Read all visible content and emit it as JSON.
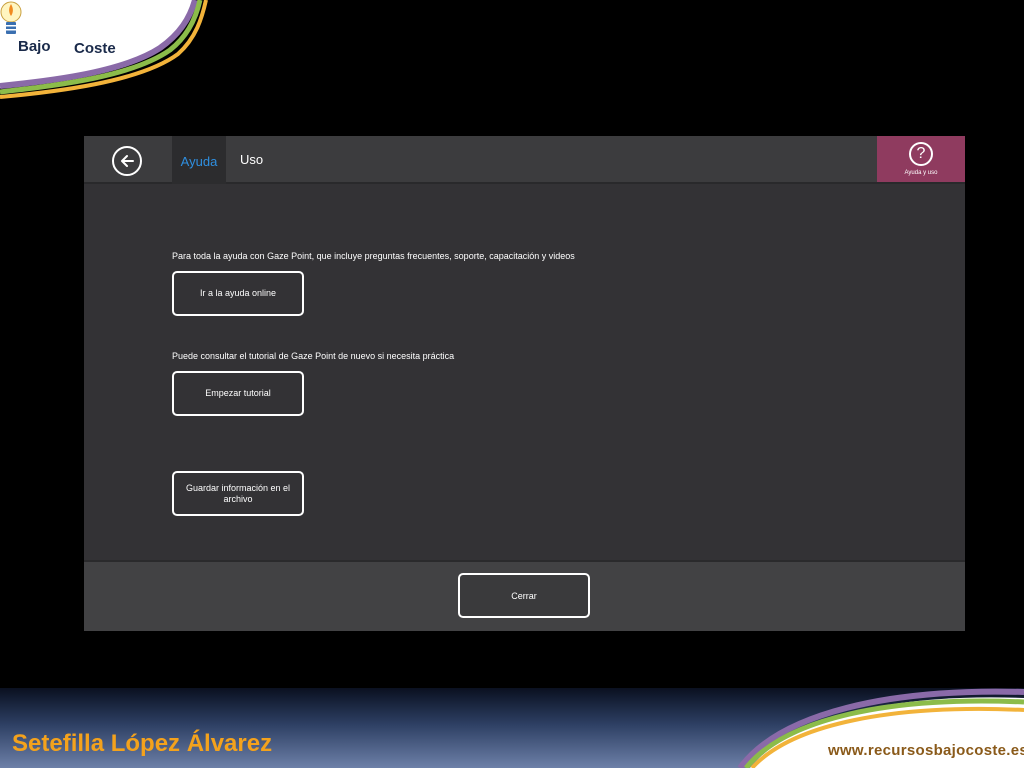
{
  "logo": {
    "word_left": "Bajo",
    "word_right": "Coste"
  },
  "app": {
    "tabs": [
      {
        "label": "Ayuda",
        "active": true
      },
      {
        "label": "Uso",
        "active": false
      }
    ],
    "help_button_label": "Ayuda y uso",
    "accent_color": "#8f3b5f",
    "active_tab_color": "#2f8fe0",
    "sections": {
      "online_desc": "Para toda la ayuda con Gaze Point, que incluye preguntas frecuentes, soporte, capacitación y videos",
      "online_button": "Ir a la ayuda online",
      "tutorial_desc": "Puede consultar el tutorial de Gaze Point de nuevo si necesita práctica",
      "tutorial_button": "Empezar tutorial",
      "save_button": "Guardar información en el archivo"
    },
    "close_button": "Cerrar"
  },
  "footer": {
    "author": "Setefilla López Álvarez",
    "website": "www.recursosbajocoste.es"
  }
}
